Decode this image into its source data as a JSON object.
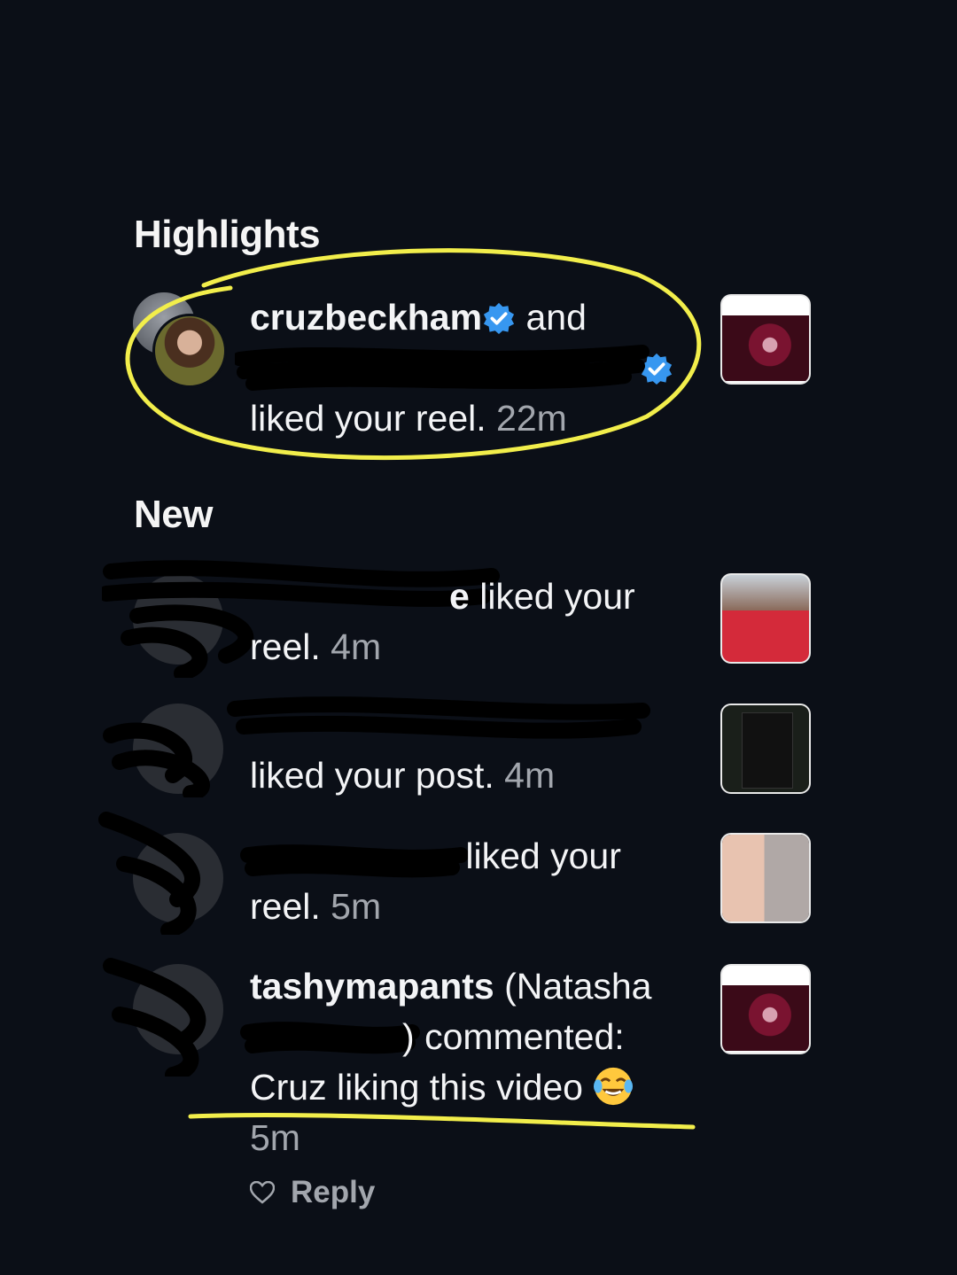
{
  "highlights": {
    "title": "Highlights",
    "item": {
      "username": "cruzbeckham",
      "connector": "and",
      "action": "liked your reel.",
      "time": "22m"
    }
  },
  "new_section": {
    "title": "New",
    "items": [
      {
        "name_suffix": "e",
        "action": "liked your",
        "action2": "reel.",
        "time": "4m"
      },
      {
        "action": "liked your post.",
        "time": "4m"
      },
      {
        "action": "liked your",
        "action2": "reel.",
        "time": "5m"
      },
      {
        "username": "tashymapants",
        "display_name_open": "(Natasha",
        "display_name_close": ")",
        "action": "commented:",
        "comment": "Cruz liking this video",
        "time": "5m",
        "reply_label": "Reply"
      }
    ]
  },
  "colors": {
    "background": "#0b0f17",
    "verified_blue": "#3797f0",
    "highlight_annotation": "#f2ee4b"
  }
}
